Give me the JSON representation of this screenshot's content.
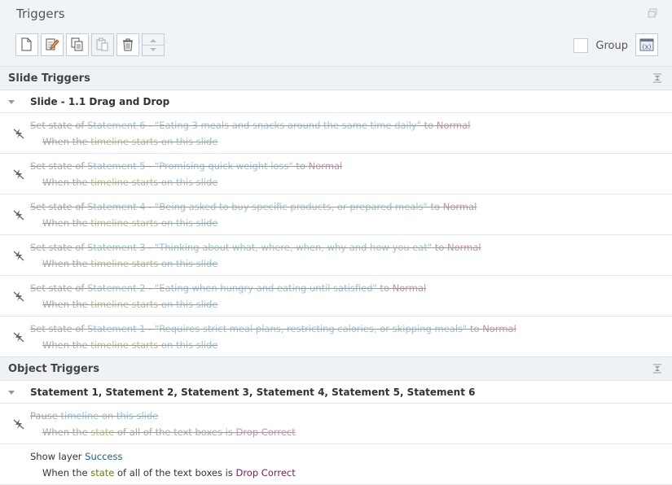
{
  "panel": {
    "title": "Triggers",
    "group_label": "Group",
    "group_checked": false
  },
  "toolbar": {
    "buttons": [
      {
        "name": "new-trigger-button",
        "icon": "new-document-icon"
      },
      {
        "name": "edit-trigger-button",
        "icon": "edit-icon"
      },
      {
        "name": "copy-trigger-button",
        "icon": "copy-icon"
      },
      {
        "name": "paste-trigger-button",
        "icon": "paste-icon"
      },
      {
        "name": "delete-trigger-button",
        "icon": "trash-icon"
      }
    ]
  },
  "sections": [
    {
      "title": "Slide Triggers",
      "group": "Slide - 1.1 Drag and Drop",
      "rows": [
        {
          "disabled": true,
          "line1": [
            {
              "t": "Set state of ",
              "k": "plain"
            },
            {
              "t": "Statement 6 - \"Eating 3 meals and snacks around the same time daily\"",
              "k": "obj"
            },
            {
              "t": " to ",
              "k": "plain"
            },
            {
              "t": "Normal",
              "k": "val"
            }
          ],
          "line2": [
            {
              "t": "When the ",
              "k": "plain"
            },
            {
              "t": "timeline starts",
              "k": "prop"
            },
            {
              "t": " on this slide",
              "k": "obj"
            }
          ]
        },
        {
          "disabled": true,
          "line1": [
            {
              "t": "Set state of ",
              "k": "plain"
            },
            {
              "t": "Statement 5 - \"Promising quick weight loss\"",
              "k": "obj"
            },
            {
              "t": " to ",
              "k": "plain"
            },
            {
              "t": "Normal",
              "k": "val"
            }
          ],
          "line2": [
            {
              "t": "When the ",
              "k": "plain"
            },
            {
              "t": "timeline starts",
              "k": "prop"
            },
            {
              "t": " on this slide",
              "k": "obj"
            }
          ]
        },
        {
          "disabled": true,
          "line1": [
            {
              "t": "Set state of ",
              "k": "plain"
            },
            {
              "t": "Statement 4 - \"Being asked to buy specific products, or prepared meals\"",
              "k": "obj"
            },
            {
              "t": " to ",
              "k": "plain"
            },
            {
              "t": "Normal",
              "k": "val"
            }
          ],
          "line2": [
            {
              "t": "When the ",
              "k": "plain"
            },
            {
              "t": "timeline starts",
              "k": "prop"
            },
            {
              "t": " on this slide",
              "k": "obj"
            }
          ]
        },
        {
          "disabled": true,
          "line1": [
            {
              "t": "Set state of ",
              "k": "plain"
            },
            {
              "t": "Statement 3 - \"Thinking about what, where, when, why and how you eat\"",
              "k": "obj"
            },
            {
              "t": " to ",
              "k": "plain"
            },
            {
              "t": "Normal",
              "k": "val"
            }
          ],
          "line2": [
            {
              "t": "When the ",
              "k": "plain"
            },
            {
              "t": "timeline starts",
              "k": "prop"
            },
            {
              "t": " on this slide",
              "k": "obj"
            }
          ]
        },
        {
          "disabled": true,
          "line1": [
            {
              "t": "Set state of ",
              "k": "plain"
            },
            {
              "t": "Statement 2 - \"Eating when hungry and eating until satisfied\"",
              "k": "obj"
            },
            {
              "t": " to ",
              "k": "plain"
            },
            {
              "t": "Normal",
              "k": "val"
            }
          ],
          "line2": [
            {
              "t": "When the ",
              "k": "plain"
            },
            {
              "t": "timeline starts",
              "k": "prop"
            },
            {
              "t": " on this slide",
              "k": "obj"
            }
          ]
        },
        {
          "disabled": true,
          "line1": [
            {
              "t": "Set state of ",
              "k": "plain"
            },
            {
              "t": "Statement 1 - \"Requires strict meal plans, restricting calories, or skipping meals\"",
              "k": "obj"
            },
            {
              "t": " to ",
              "k": "plain"
            },
            {
              "t": "Normal",
              "k": "val"
            }
          ],
          "line2": [
            {
              "t": "When the ",
              "k": "plain"
            },
            {
              "t": "timeline starts",
              "k": "prop"
            },
            {
              "t": " on this slide",
              "k": "obj"
            }
          ]
        }
      ]
    },
    {
      "title": "Object Triggers",
      "group": "Statement 1, Statement 2, Statement 3, Statement 4, Statement 5, Statement 6",
      "rows": [
        {
          "disabled": true,
          "line1": [
            {
              "t": "Pause ",
              "k": "plain"
            },
            {
              "t": "timeline on this slide",
              "k": "obj"
            }
          ],
          "line2": [
            {
              "t": "When the ",
              "k": "plain"
            },
            {
              "t": "state",
              "k": "prop"
            },
            {
              "t": " of all of the text boxes is ",
              "k": "plain"
            },
            {
              "t": "Drop Correct",
              "k": "val"
            }
          ]
        },
        {
          "disabled": false,
          "line1": [
            {
              "t": "Show layer ",
              "k": "plain"
            },
            {
              "t": "Success",
              "k": "obj"
            }
          ],
          "line2": [
            {
              "t": "When the ",
              "k": "plain"
            },
            {
              "t": "state",
              "k": "prop"
            },
            {
              "t": " of all of the text boxes is ",
              "k": "plain"
            },
            {
              "t": "Drop Correct",
              "k": "val"
            }
          ]
        }
      ]
    }
  ]
}
